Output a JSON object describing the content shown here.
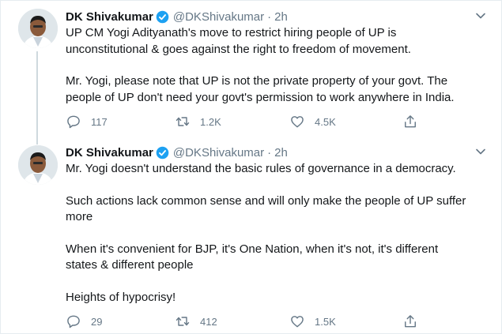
{
  "tweets": [
    {
      "name": "DK Shivakumar",
      "handle": "@DKShivakumar",
      "separator": "·",
      "time": "2h",
      "lines": [
        "UP CM Yogi Adityanath's move to restrict hiring people of UP is",
        "unconstitutional & goes against the right to freedom of movement.",
        "",
        "Mr. Yogi, please note that UP is not the private property of your govt. The",
        "people of UP don't need your govt's permission to work anywhere in India."
      ],
      "replies": "117",
      "retweets": "1.2K",
      "likes": "4.5K"
    },
    {
      "name": "DK Shivakumar",
      "handle": "@DKShivakumar",
      "separator": "·",
      "time": "2h",
      "lines": [
        "Mr. Yogi doesn't understand the basic rules of governance in a democracy.",
        "",
        "Such actions lack common sense and will only make the people of UP suffer",
        "more",
        "",
        "When it's convenient for BJP, it's One Nation, when it's not, it's different",
        "states & different people",
        "",
        "Heights of hypocrisy!"
      ],
      "replies": "29",
      "retweets": "412",
      "likes": "1.5K"
    }
  ],
  "colors": {
    "text": "#14171a",
    "secondary": "#657786",
    "verified": "#1da1f2",
    "thread_line": "#cfd9de"
  },
  "icons": [
    "verified-badge-icon",
    "chevron-down-icon",
    "reply-icon",
    "retweet-icon",
    "like-icon",
    "share-icon"
  ]
}
